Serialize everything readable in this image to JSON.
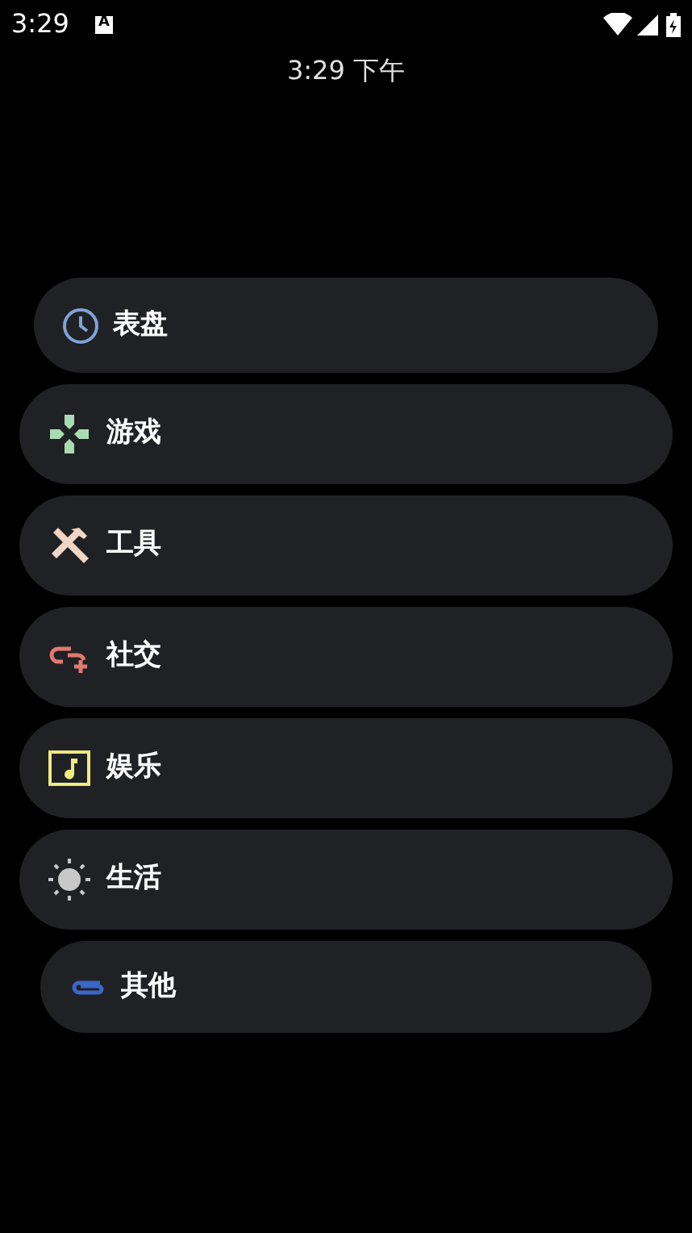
{
  "status_bar": {
    "time": "3:29",
    "notification": "A"
  },
  "clock": "3:29 下午",
  "categories": [
    {
      "label": "表盘"
    },
    {
      "label": "游戏"
    },
    {
      "label": "工具"
    },
    {
      "label": "社交"
    },
    {
      "label": "娱乐"
    },
    {
      "label": "生活"
    },
    {
      "label": "其他"
    }
  ]
}
